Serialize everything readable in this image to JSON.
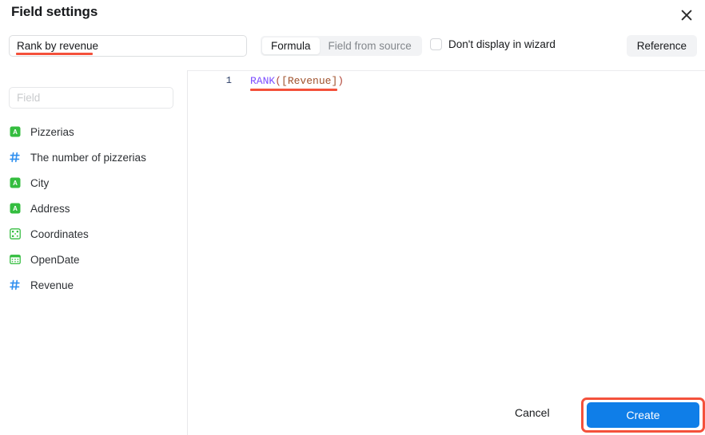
{
  "dialog": {
    "title": "Field settings",
    "close_icon": "close-icon"
  },
  "toolbar": {
    "name_value": "Rank by revenue",
    "name_placeholder": "",
    "mode_options": [
      {
        "label": "Formula",
        "active": true
      },
      {
        "label": "Field from source",
        "active": false
      }
    ],
    "wizard_checkbox_label": "Don't display in wizard",
    "wizard_checkbox_checked": false,
    "reference_label": "Reference"
  },
  "field_panel": {
    "search_placeholder": "Field",
    "search_value": "",
    "items": [
      {
        "label": "Pizzerias",
        "icon": "text-type-icon",
        "icon_color": "#33bb44"
      },
      {
        "label": "The number of pizzerias",
        "icon": "number-type-icon",
        "icon_color": "#2f8fef"
      },
      {
        "label": "City",
        "icon": "text-type-icon",
        "icon_color": "#33bb44"
      },
      {
        "label": "Address",
        "icon": "text-type-icon",
        "icon_color": "#33bb44"
      },
      {
        "label": "Coordinates",
        "icon": "geopoint-type-icon",
        "icon_color": "#33bb44"
      },
      {
        "label": "OpenDate",
        "icon": "date-type-icon",
        "icon_color": "#33bb44"
      },
      {
        "label": "Revenue",
        "icon": "number-type-icon",
        "icon_color": "#2f8fef"
      }
    ]
  },
  "editor": {
    "line_number": "1",
    "formula_tokens": [
      {
        "text": "RANK",
        "kind": "function"
      },
      {
        "text": "(",
        "kind": "punct"
      },
      {
        "text": "[Revenue]",
        "kind": "field"
      },
      {
        "text": ")",
        "kind": "punct"
      }
    ],
    "formula_plain": "RANK([Revenue])"
  },
  "footer": {
    "cancel_label": "Cancel",
    "create_label": "Create"
  },
  "annotations": {
    "highlight_color": "#f4513b",
    "accent_color": "#0f7ee8"
  }
}
